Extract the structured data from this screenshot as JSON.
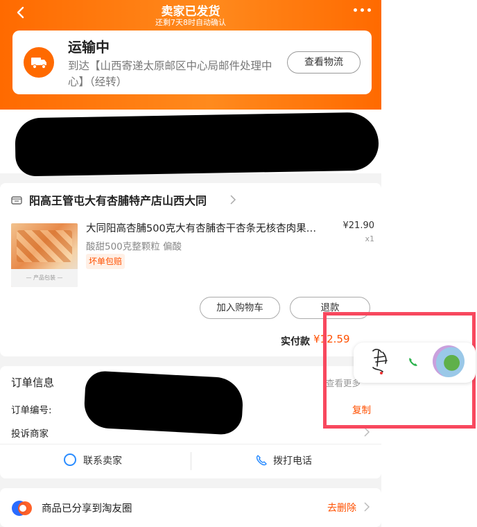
{
  "header": {
    "title": "卖家已发货",
    "subtitle": "还剩7天8时自动确认"
  },
  "shipping": {
    "status": "运输中",
    "detail": "到达【山西寄递太原邮区中心局邮件处理中心】（经转）",
    "button_label": "查看物流"
  },
  "order": {
    "store_name": "阳高王管屯大有杏脯特产店山西大同",
    "product": {
      "title": "大同阳高杏脯500克大有杏脯杏干杏条无核杏肉果…",
      "price": "¥21.90",
      "spec": "酸甜500克整颗粒 偏酸",
      "quantity": "x1",
      "guarantee": "坏单包赔",
      "thumb_caption": "— 产品包装 —"
    },
    "add_to_cart_label": "加入购物车",
    "refund_label": "退款",
    "paid_label": "实付款",
    "paid_amount": "¥12.59"
  },
  "order_info": {
    "title": "订单信息",
    "more": "查看更多",
    "order_no_label": "订单编号:",
    "copy_label": "复制",
    "complain_label": "投诉商家",
    "contact_seller": "联系卖家",
    "call": "拨打电话"
  },
  "share": {
    "text": "商品已分享到淘友圈",
    "delete_label": "去删除"
  },
  "colors": {
    "accent": "#ff6a00",
    "price": "#ff5000",
    "highlight_box": "#f8485e"
  }
}
